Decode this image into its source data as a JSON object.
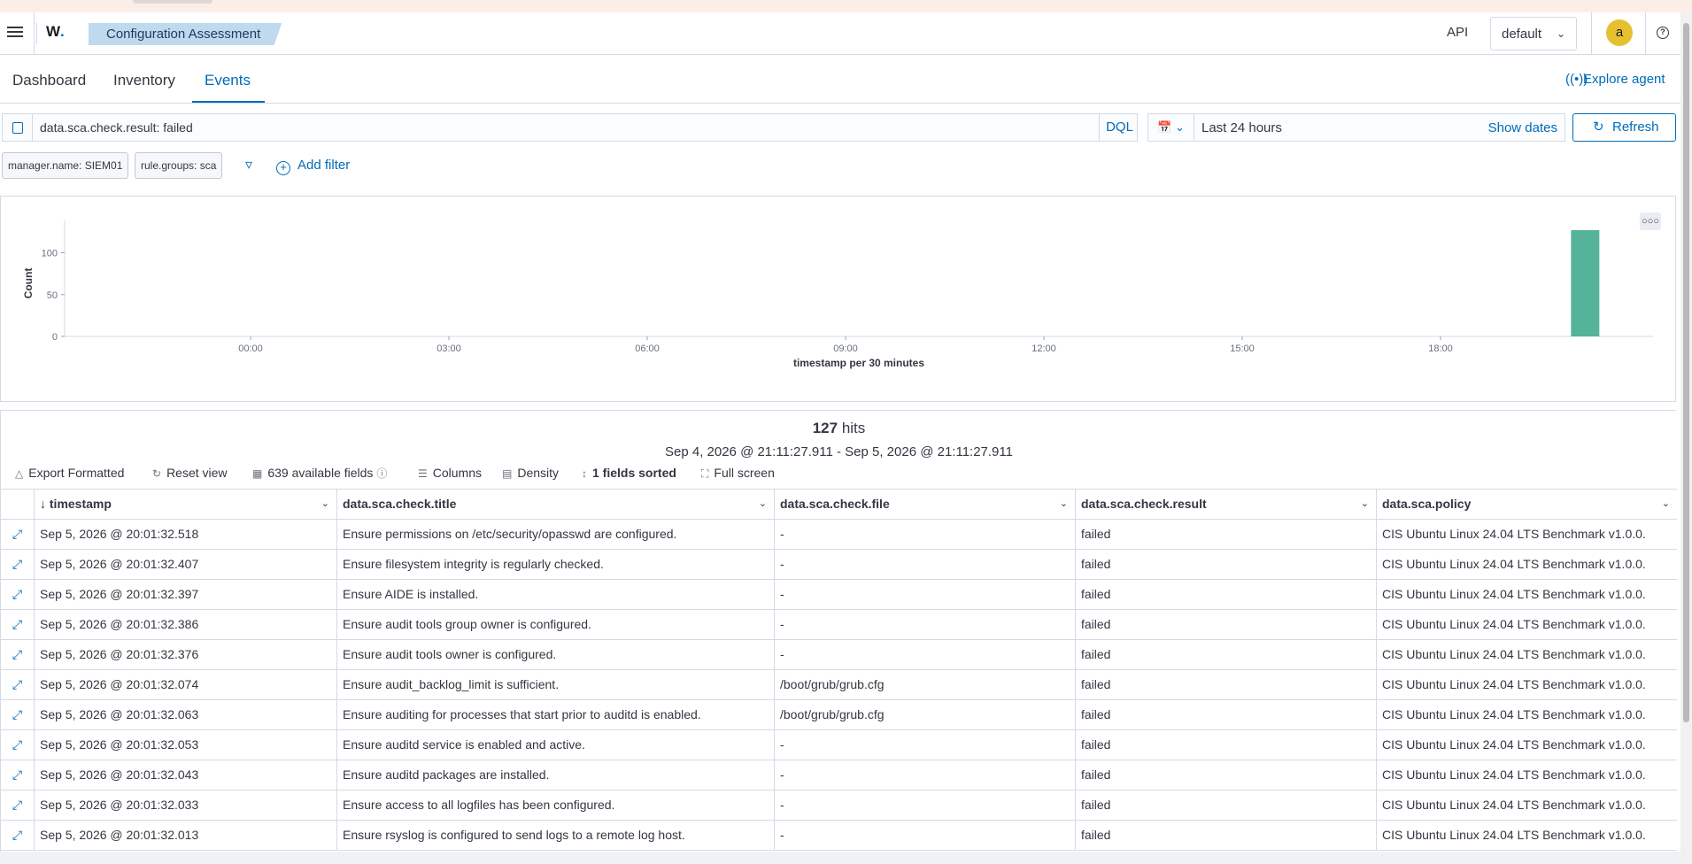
{
  "header": {
    "logo": "W",
    "logo_dot": ".",
    "breadcrumb": "Configuration Assessment",
    "api_label": "API",
    "index_select": "default",
    "avatar_initial": "a"
  },
  "tabs": [
    {
      "label": "Dashboard"
    },
    {
      "label": "Inventory"
    },
    {
      "label": "Events"
    }
  ],
  "explore_agent": "Explore agent",
  "search": {
    "query": "data.sca.check.result: failed",
    "language": "DQL",
    "time_range": "Last 24 hours",
    "show_dates": "Show dates",
    "refresh": "Refresh"
  },
  "filters": {
    "chips": [
      "manager.name: SIEM01",
      "rule.groups: sca"
    ],
    "add_filter": "Add filter"
  },
  "chart_data": {
    "type": "bar",
    "ylabel": "Count",
    "xlabel": "timestamp per 30 minutes",
    "ylim": [
      0,
      130
    ],
    "yticks": [
      "0",
      "50",
      "100"
    ],
    "xticks": [
      "00:00",
      "03:00",
      "06:00",
      "09:00",
      "12:00",
      "15:00",
      "18:00"
    ],
    "bars": [
      {
        "x": "20:00",
        "value": 127
      }
    ],
    "color": "#54b399"
  },
  "results": {
    "hits_count": "127",
    "hits_label": "hits",
    "date_range": "Sep 4, 2026 @ 21:11:27.911 - Sep 5, 2026 @ 21:11:27.911",
    "toolbar": {
      "export": "Export Formatted",
      "reset": "Reset view",
      "fields": "639 available fields",
      "columns": "Columns",
      "density": "Density",
      "sorted": "1 fields sorted",
      "fullscreen": "Full screen"
    },
    "columns": [
      "timestamp",
      "data.sca.check.title",
      "data.sca.check.file",
      "data.sca.check.result",
      "data.sca.policy"
    ],
    "rows": [
      [
        "Sep 5, 2026 @ 20:01:32.518",
        "Ensure permissions on /etc/security/opasswd are configured.",
        "-",
        "failed",
        "CIS Ubuntu Linux 24.04 LTS Benchmark v1.0.0."
      ],
      [
        "Sep 5, 2026 @ 20:01:32.407",
        "Ensure filesystem integrity is regularly checked.",
        "-",
        "failed",
        "CIS Ubuntu Linux 24.04 LTS Benchmark v1.0.0."
      ],
      [
        "Sep 5, 2026 @ 20:01:32.397",
        "Ensure AIDE is installed.",
        "-",
        "failed",
        "CIS Ubuntu Linux 24.04 LTS Benchmark v1.0.0."
      ],
      [
        "Sep 5, 2026 @ 20:01:32.386",
        "Ensure audit tools group owner is configured.",
        "-",
        "failed",
        "CIS Ubuntu Linux 24.04 LTS Benchmark v1.0.0."
      ],
      [
        "Sep 5, 2026 @ 20:01:32.376",
        "Ensure audit tools owner is configured.",
        "-",
        "failed",
        "CIS Ubuntu Linux 24.04 LTS Benchmark v1.0.0."
      ],
      [
        "Sep 5, 2026 @ 20:01:32.074",
        "Ensure audit_backlog_limit is sufficient.",
        "/boot/grub/grub.cfg",
        "failed",
        "CIS Ubuntu Linux 24.04 LTS Benchmark v1.0.0."
      ],
      [
        "Sep 5, 2026 @ 20:01:32.063",
        "Ensure auditing for processes that start prior to auditd is enabled.",
        "/boot/grub/grub.cfg",
        "failed",
        "CIS Ubuntu Linux 24.04 LTS Benchmark v1.0.0."
      ],
      [
        "Sep 5, 2026 @ 20:01:32.053",
        "Ensure auditd service is enabled and active.",
        "-",
        "failed",
        "CIS Ubuntu Linux 24.04 LTS Benchmark v1.0.0."
      ],
      [
        "Sep 5, 2026 @ 20:01:32.043",
        "Ensure auditd packages are installed.",
        "-",
        "failed",
        "CIS Ubuntu Linux 24.04 LTS Benchmark v1.0.0."
      ],
      [
        "Sep 5, 2026 @ 20:01:32.033",
        "Ensure access to all logfiles has been configured.",
        "-",
        "failed",
        "CIS Ubuntu Linux 24.04 LTS Benchmark v1.0.0."
      ],
      [
        "Sep 5, 2026 @ 20:01:32.013",
        "Ensure rsyslog is configured to send logs to a remote log host.",
        "-",
        "failed",
        "CIS Ubuntu Linux 24.04 LTS Benchmark v1.0.0."
      ]
    ]
  }
}
